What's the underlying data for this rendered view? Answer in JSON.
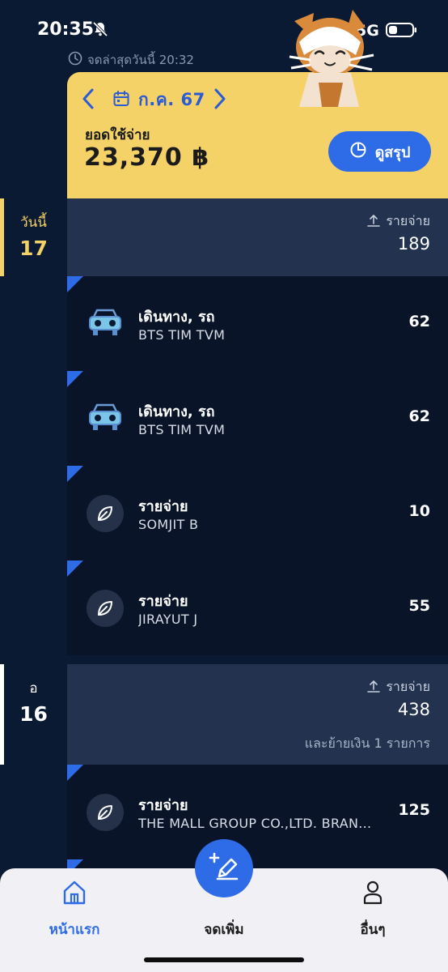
{
  "status_bar": {
    "time": "20:35",
    "network": "5G"
  },
  "last_recorded": "จดล่าสุดวันนี้ 20:32",
  "summary": {
    "month": "ก.ค. 67",
    "spend_label": "ยอดใช้จ่าย",
    "spend_total": "23,370 ฿",
    "button_label": "ดูสรุป"
  },
  "days": [
    {
      "day_name": "วันนี้",
      "day_num": "17",
      "accent": "#f4d267",
      "header": {
        "label": "รายจ่าย",
        "total": "189",
        "note": ""
      },
      "transactions": [
        {
          "icon": "car-icon",
          "title": "เดินทาง, รถ",
          "subtitle": "BTS TIM TVM",
          "amount": "62"
        },
        {
          "icon": "car-icon",
          "title": "เดินทาง, รถ",
          "subtitle": "BTS TIM TVM",
          "amount": "62"
        },
        {
          "icon": "leaf-icon",
          "title": "รายจ่าย",
          "subtitle": "SOMJIT B",
          "amount": "10"
        },
        {
          "icon": "leaf-icon",
          "title": "รายจ่าย",
          "subtitle": "JIRAYUT J",
          "amount": "55"
        }
      ]
    },
    {
      "day_name": "อ",
      "day_num": "16",
      "accent": "#ffffff",
      "header": {
        "label": "รายจ่าย",
        "total": "438",
        "note": "และย้ายเงิน 1 รายการ"
      },
      "transactions": [
        {
          "icon": "leaf-icon",
          "title": "รายจ่าย",
          "subtitle": "THE MALL GROUP CO.,LTD. BRAN...",
          "amount": "125"
        }
      ]
    }
  ],
  "nav": {
    "home": "หน้าแรก",
    "add": "จดเพิ่ม",
    "more": "อื่นๆ"
  },
  "colors": {
    "background": "#0b1a33",
    "card_yellow": "#f4d267",
    "accent_blue": "#2e6be6",
    "row_bg": "#091429",
    "header_bg": "#22324f"
  }
}
